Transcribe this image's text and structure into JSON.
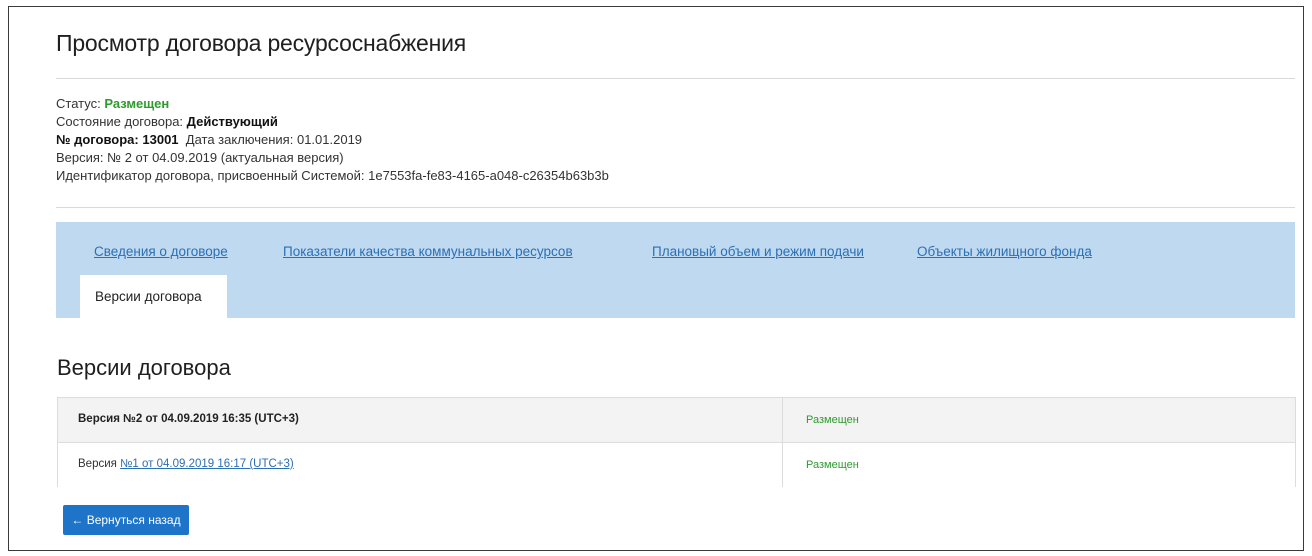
{
  "page": {
    "title": "Просмотр договора ресурсоснабжения"
  },
  "info": {
    "status_label": "Статус:",
    "status_value": "Размещен",
    "state_label": "Состояние договора:",
    "state_value": "Действующий",
    "number_label": "№ договора:",
    "number_value": "13001",
    "date_label": "Дата заключения:",
    "date_value": "01.01.2019",
    "version_text": "Версия: № 2 от 04.09.2019 (актуальная версия)",
    "identifier_text": "Идентификатор договора, присвоенный Системой: 1e7553fa-fe83-4165-a048-c26354b63b3b"
  },
  "tabs": [
    {
      "label": "Сведения о договоре"
    },
    {
      "label": "Показатели качества коммунальных ресурсов"
    },
    {
      "label": "Плановый объем и режим подачи"
    },
    {
      "label": "Объекты жилищного фонда"
    },
    {
      "label": "Версии договора"
    }
  ],
  "section": {
    "title": "Версии договора"
  },
  "versions": [
    {
      "name": "Версия №2 от 04.09.2019 16:35 (UTC+3)",
      "status": "Размещен"
    },
    {
      "prefix": "Версия",
      "link": "№1 от 04.09.2019 16:17 (UTC+3)",
      "status": "Размещен"
    }
  ],
  "back_button": {
    "label": "← Вернуться назад"
  },
  "colors": {
    "tab_panel": "#bfd9f0",
    "link": "#2c6fb4",
    "status_green": "#2e9a2e",
    "button": "#1e74c9"
  }
}
